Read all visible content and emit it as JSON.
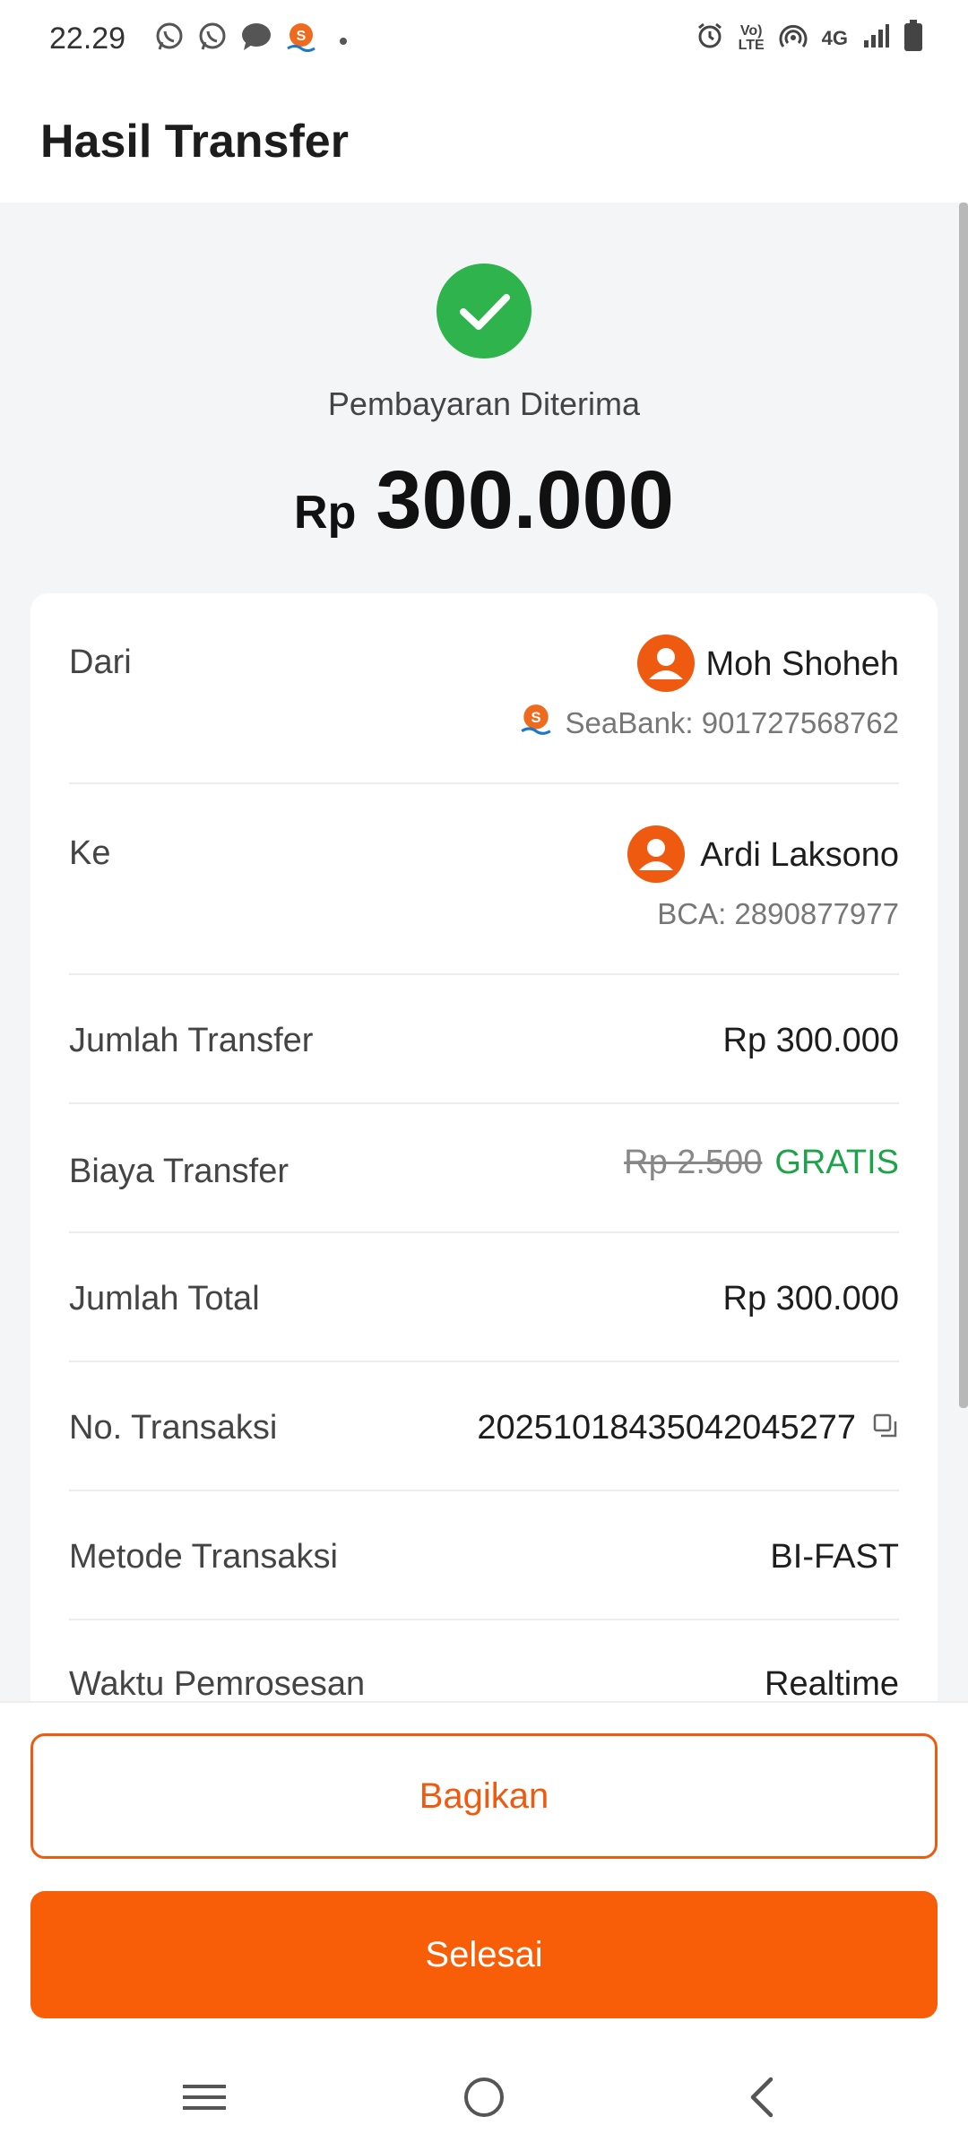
{
  "status_bar": {
    "time": "22.29",
    "left_icons": [
      "whatsapp-icon",
      "whatsapp-icon",
      "message-icon",
      "seabank-icon",
      "dot-icon"
    ],
    "right_icons": [
      "alarm-icon",
      "volte-icon",
      "hotspot-icon",
      "4g-icon",
      "signal-icon",
      "battery-icon"
    ],
    "network": "4G",
    "volte_top": "Vo)",
    "volte_bottom": "LTE"
  },
  "header": {
    "title": "Hasil Transfer"
  },
  "result": {
    "status": "Pembayaran Diterima",
    "currency": "Rp",
    "amount": "300.000"
  },
  "details": {
    "from": {
      "label": "Dari",
      "name": "Moh Shoheh",
      "account": "SeaBank: 901727568762"
    },
    "to": {
      "label": "Ke",
      "name": "Ardi Laksono",
      "account": "BCA: 2890877977"
    },
    "transfer_amount": {
      "label": "Jumlah Transfer",
      "value": "Rp 300.000"
    },
    "transfer_fee": {
      "label": "Biaya Transfer",
      "original": "Rp 2.500",
      "value": "GRATIS"
    },
    "total_amount": {
      "label": "Jumlah Total",
      "value": "Rp 300.000"
    },
    "transaction_no": {
      "label": "No. Transaksi",
      "value": "20251018435042045277"
    },
    "method": {
      "label": "Metode Transaksi",
      "value": "BI-FAST"
    },
    "processing_time": {
      "label": "Waktu Pemrosesan",
      "value": "Realtime"
    }
  },
  "actions": {
    "share": "Bagikan",
    "done": "Selesai"
  },
  "colors": {
    "accent": "#f85e08",
    "success": "#2fb34d",
    "free_text": "#1fa34a",
    "background": "#f4f5f7"
  }
}
